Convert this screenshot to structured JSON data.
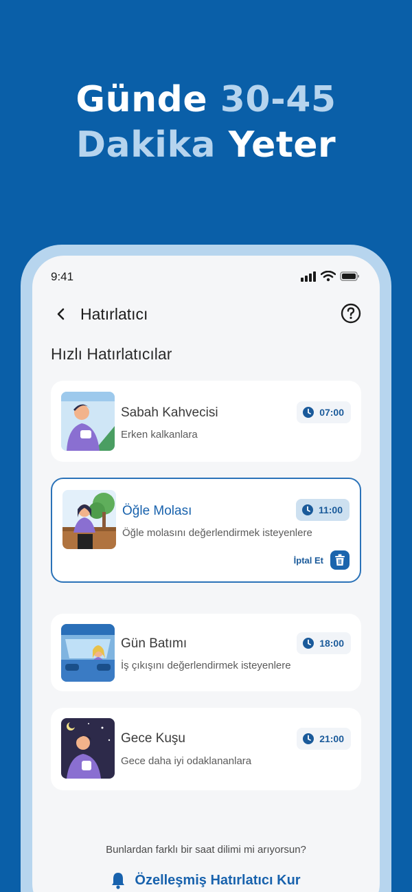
{
  "headline": {
    "line1_plain": "Günde ",
    "line1_accent": "30-45",
    "line2_accent": "Dakika",
    "line2_plain": " Yeter"
  },
  "status_bar": {
    "time": "9:41"
  },
  "nav": {
    "title": "Hatırlatıcı"
  },
  "section_title": "Hızlı Hatırlatıcılar",
  "reminders": [
    {
      "title": "Sabah Kahvecisi",
      "subtitle": "Erken kalkanlara",
      "time": "07:00",
      "active": false
    },
    {
      "title": "Öğle Molası",
      "subtitle": "Öğle molasını değerlendirmek isteyenlere",
      "time": "11:00",
      "active": true,
      "cancel_label": "İptal Et"
    },
    {
      "title": "Gün Batımı",
      "subtitle": "İş çıkışını değerlendirmek isteyenlere",
      "time": "18:00",
      "active": false
    },
    {
      "title": "Gece Kuşu",
      "subtitle": "Gece daha iyi odaklananlara",
      "time": "21:00",
      "active": false
    }
  ],
  "footer": {
    "question": "Bunlardan farklı bir saat dilimi mi arıyorsun?",
    "cta_label": "Özelleşmiş Hatırlatıcı Kur"
  },
  "colors": {
    "background": "#0a5fa8",
    "accent": "#b6d4ee",
    "brand": "#1862ad"
  },
  "icons": [
    "back-icon",
    "help-icon",
    "clock-icon",
    "trash-icon",
    "bell-icon",
    "signal-icon",
    "wifi-icon",
    "battery-icon"
  ]
}
